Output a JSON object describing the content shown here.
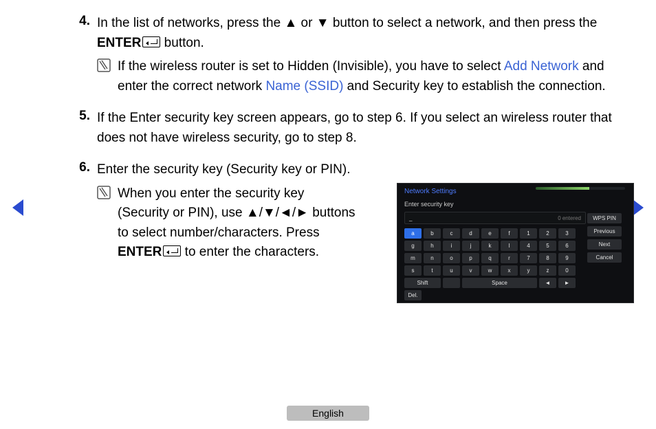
{
  "steps": {
    "s4": {
      "num": "4.",
      "t1": "In the list of networks, press the ",
      "t_up": "▲",
      "t2": " or ",
      "t_dn": "▼",
      "t3": " button to select a network, and then press the ",
      "enter": "ENTER",
      "t4": " button.",
      "note": {
        "pre": "If the wireless router is set to Hidden (Invisible), you have to select ",
        "link1": "Add Network",
        "mid": " and enter the correct network ",
        "link2": "Name (SSID)",
        "post": " and Security key to establish the connection."
      }
    },
    "s5": {
      "num": "5.",
      "text": "If the Enter security key screen appears, go to step 6. If you select an wireless router that does not have wireless security, go to step 8."
    },
    "s6": {
      "num": "6.",
      "text": "Enter the security key (Security key or PIN).",
      "note": {
        "t1": "When you enter the security key (Security or PIN), use ",
        "arrows": "▲/▼/◄/►",
        "t2": " buttons to select number/characters. Press ",
        "enter": "ENTER",
        "t3": " to enter the characters."
      }
    }
  },
  "panel": {
    "title": "Network Settings",
    "subtitle": "Enter security key",
    "entered_label": "0 entered",
    "cursor": "_",
    "side": [
      "WPS PIN",
      "Previous",
      "Next",
      "Cancel"
    ],
    "rows": [
      [
        "a",
        "b",
        "c",
        "d",
        "e",
        "f",
        "1",
        "2",
        "3"
      ],
      [
        "g",
        "h",
        "i",
        "j",
        "k",
        "l",
        "4",
        "5",
        "6"
      ],
      [
        "m",
        "n",
        "o",
        "p",
        "q",
        "r",
        "7",
        "8",
        "9"
      ],
      [
        "s",
        "t",
        "u",
        "v",
        "w",
        "x",
        "y",
        "z",
        "0"
      ]
    ],
    "bottom": {
      "shift": "Shift",
      "star": "",
      "space": "Space",
      "left": "◄",
      "right": "►",
      "del": "Del."
    }
  },
  "footer": {
    "language": "English"
  }
}
